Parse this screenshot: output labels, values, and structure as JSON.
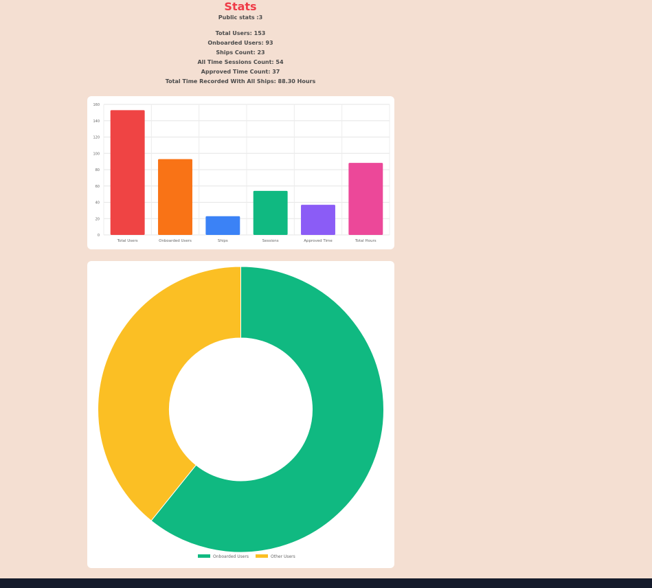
{
  "header": {
    "title": "Stats",
    "subtitle": "Public stats :3"
  },
  "stats": [
    "Total Users: 153",
    "Onboarded Users: 93",
    "Ships Count: 23",
    "All Time Sessions Count: 54",
    "Approved Time Count: 37",
    "Total Time Recorded With All Ships: 88.30 Hours"
  ],
  "chart_data": [
    {
      "type": "bar",
      "categories": [
        "Total Users",
        "Onboarded Users",
        "Ships",
        "Sessions",
        "Approved Time",
        "Total Hours"
      ],
      "values": [
        153,
        93,
        23,
        54,
        37,
        88.3
      ],
      "colors": [
        "#ef4444",
        "#f97316",
        "#3b82f6",
        "#10b981",
        "#8b5cf6",
        "#ec4899"
      ],
      "ylim": [
        0,
        160
      ],
      "yticks": [
        0,
        20,
        40,
        60,
        80,
        100,
        120,
        140,
        160
      ],
      "grid": true
    },
    {
      "type": "pie",
      "style": "doughnut",
      "labels": [
        "Onboarded Users",
        "Other Users"
      ],
      "values": [
        93,
        60
      ],
      "colors": [
        "#10b981",
        "#fbbf24"
      ],
      "legend": "bottom"
    }
  ]
}
